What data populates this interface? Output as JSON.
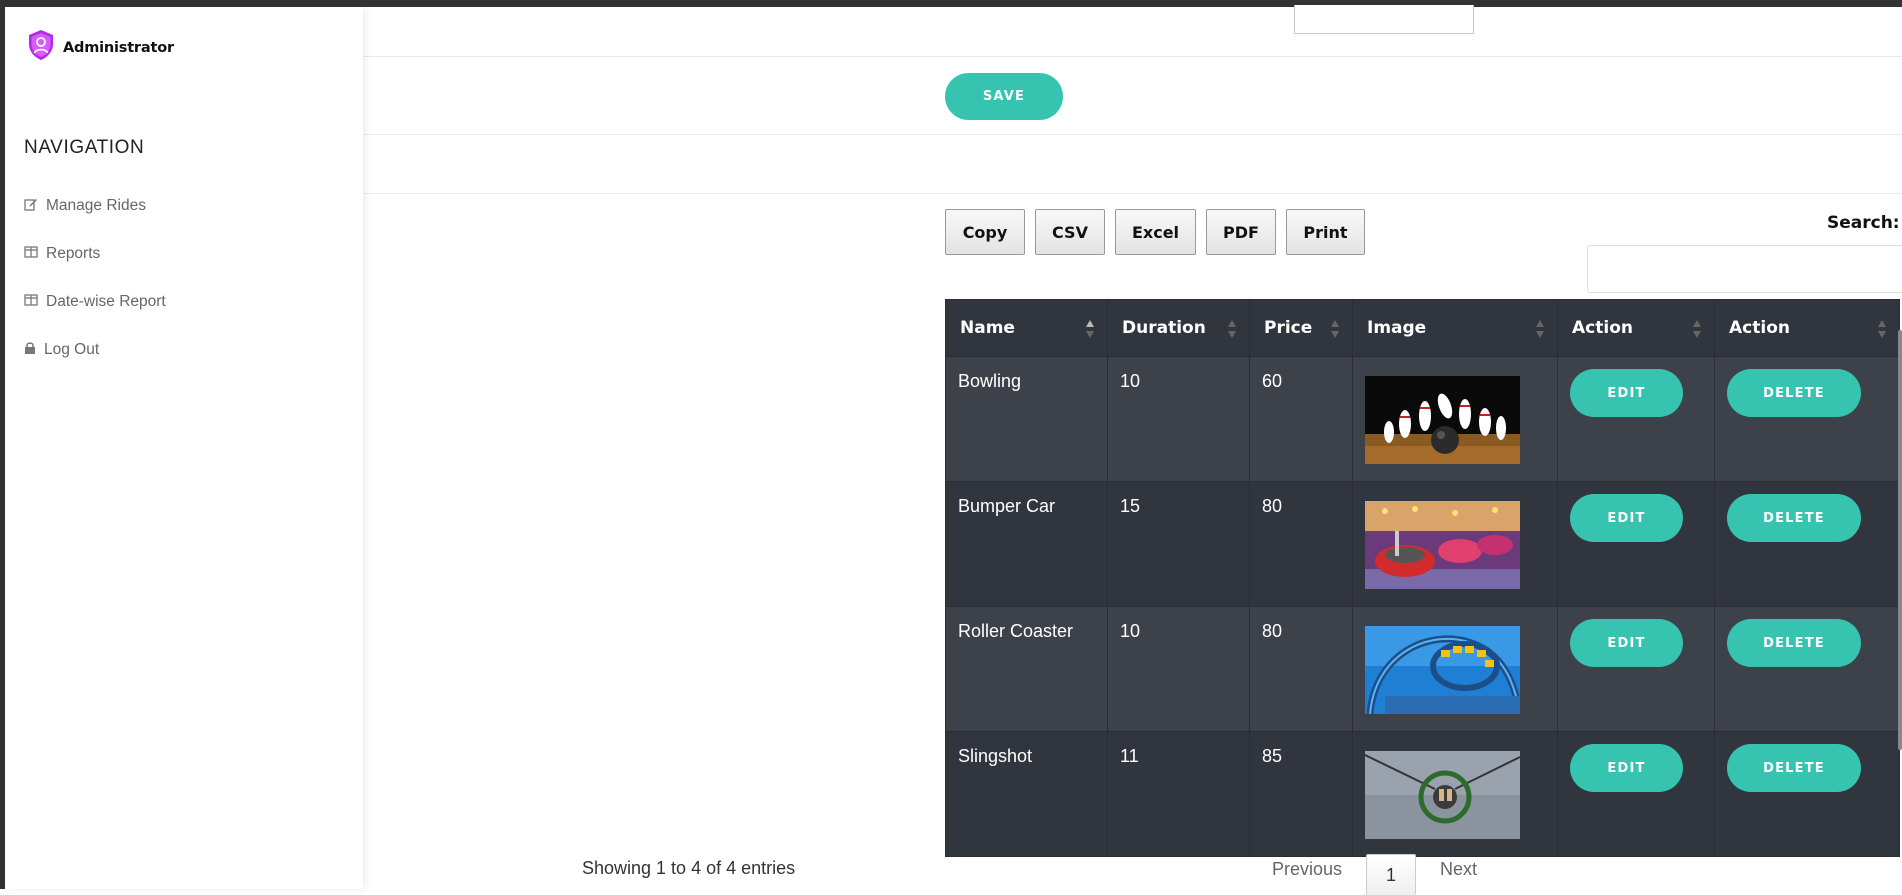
{
  "sidebar": {
    "brand": "Administrator",
    "nav_heading": "NAVIGATION",
    "items": [
      {
        "label": "Manage Rides",
        "icon": "edit-icon"
      },
      {
        "label": "Reports",
        "icon": "table-icon"
      },
      {
        "label": "Date-wise Report",
        "icon": "table-icon"
      },
      {
        "label": "Log Out",
        "icon": "lock-icon"
      }
    ]
  },
  "form": {
    "save_label": "SAVE"
  },
  "toolbar": {
    "copy": "Copy",
    "csv": "CSV",
    "excel": "Excel",
    "pdf": "PDF",
    "print": "Print",
    "search_label": "Search:",
    "search_value": ""
  },
  "table": {
    "headers": [
      "Name",
      "Duration",
      "Price",
      "Image",
      "Action",
      "Action"
    ],
    "rows": [
      {
        "name": "Bowling",
        "duration": "10",
        "price": "60",
        "image": "bowling-image",
        "edit": "EDIT",
        "delete": "DELETE"
      },
      {
        "name": "Bumper Car",
        "duration": "15",
        "price": "80",
        "image": "bumper-car-image",
        "edit": "EDIT",
        "delete": "DELETE"
      },
      {
        "name": "Roller Coaster",
        "duration": "10",
        "price": "80",
        "image": "roller-coaster-image",
        "edit": "EDIT",
        "delete": "DELETE"
      },
      {
        "name": "Slingshot",
        "duration": "11",
        "price": "85",
        "image": "slingshot-image",
        "edit": "EDIT",
        "delete": "DELETE"
      }
    ]
  },
  "footer": {
    "info": "Showing 1 to 4 of 4 entries",
    "previous": "Previous",
    "page": "1",
    "next": "Next"
  },
  "colors": {
    "accent": "#36c4b1",
    "brand_icon": "#c02cf0",
    "table_header": "#31353d",
    "row_odd": "#3d424a",
    "row_even": "#31353d"
  }
}
